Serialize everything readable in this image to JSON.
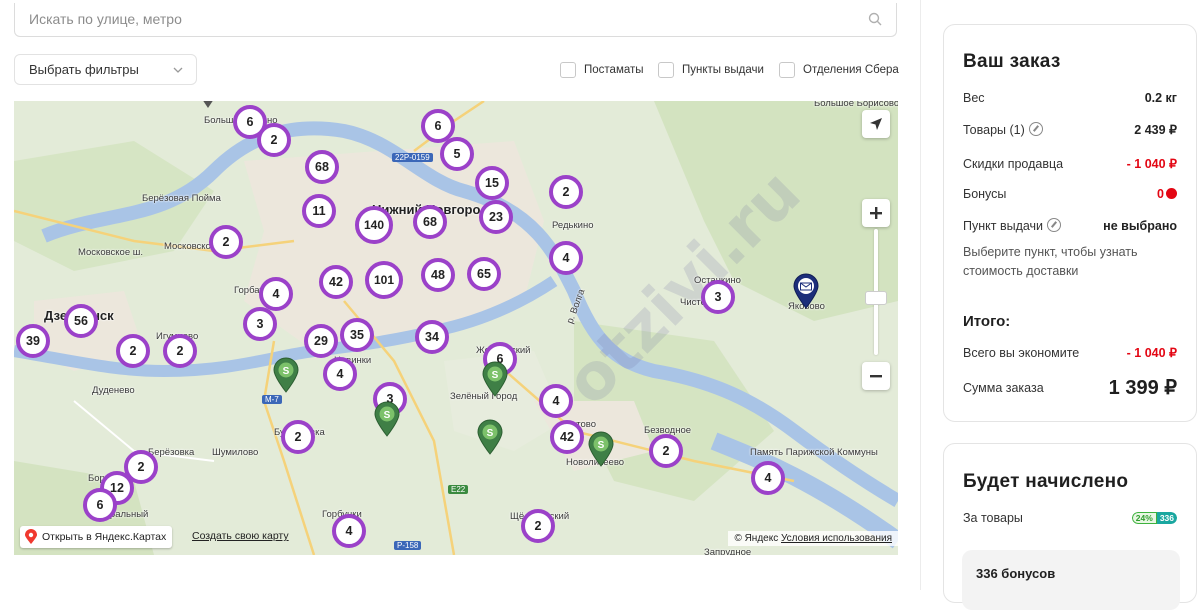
{
  "search": {
    "placeholder": "Искать по улице, метро"
  },
  "filters": {
    "select_label": "Выбрать фильтры",
    "checkboxes": [
      "Постаматы",
      "Пункты выдачи",
      "Отделения Сбера"
    ]
  },
  "map": {
    "watermark": "otzivi.ru",
    "labels": {
      "bolshoe_kozino": "Большое Козино",
      "berezovaya_poyma": "Берёзовая Пойма",
      "moskovskoe_sh_1": "Московское ш.",
      "moskovskoe_sh_2": "Московское ш.",
      "nizhny": "Нижний Новгород",
      "redkino": "Редькино",
      "dzerzhinsk": "Дзержинск",
      "gorbatovka": "Горбатовка",
      "igumnovo": "Игумново",
      "dudenevo": "Дуденево",
      "zelenyi_gorod": "Зелёный Город",
      "zhelninsky": "Желнинский",
      "kstovo": "Кстово",
      "novolikeevo": "Новоликеево",
      "bezvodnoe": "Безводное",
      "ostankino": "Останкино",
      "chistoe": "Чистое",
      "yakovo": "Яковово",
      "pamyat": "Память Парижской Коммуны",
      "shumilovo": "Шумилово",
      "berezovka": "Берёзовка",
      "bor": "Бор",
      "tsentralny": "Центральный",
      "burnakovo": "Бурнаковка",
      "novaya_pustyn": "Новинки",
      "gorbunovo": "Горбунки",
      "shchelokovo": "Щёлоковский",
      "volga": "р. Волга",
      "zapolnoe": "Запрудное",
      "top_right": "Большое Борисово"
    },
    "roads": {
      "r1": "22Р-0159",
      "r2": "M-7",
      "r3": "E22",
      "r4": "P-158"
    },
    "clusters": [
      "6",
      "2",
      "6",
      "5",
      "68",
      "15",
      "2",
      "11",
      "140",
      "68",
      "23",
      "2",
      "4",
      "4",
      "42",
      "101",
      "48",
      "65",
      "3",
      "56",
      "3",
      "39",
      "29",
      "35",
      "34",
      "2",
      "2",
      "6",
      "4",
      "3",
      "4",
      "42",
      "2",
      "2",
      "2",
      "4",
      "12",
      "6",
      "4",
      "2"
    ],
    "open_in_yandex": "Открыть в Яндекс.Картах",
    "make_map": "Создать свою карту",
    "attribution": "© Яндекс",
    "terms": "Условия использования",
    "colors": {
      "cluster": "#9b41c9",
      "sber_pin": "#2e8b3a",
      "post_pin": "#1c2e7a"
    }
  },
  "order": {
    "title": "Ваш заказ",
    "weight_label": "Вес",
    "weight_value": "0.2 кг",
    "goods_label": "Товары (1)",
    "goods_value": "2 439 ₽",
    "seller_discount_label": "Скидки продавца",
    "seller_discount_value": "- 1 040 ₽",
    "bonuses_label": "Бонусы",
    "bonuses_value": "0",
    "pickup_label": "Пункт выдачи",
    "pickup_value": "не выбрано",
    "pickup_hint": "Выберите пункт, чтобы узнать стоимость доставки",
    "total_title": "Итого:",
    "saved_label": "Всего вы экономите",
    "saved_value": "- 1 040 ₽",
    "sum_label": "Сумма заказа",
    "sum_value": "1 399 ₽",
    "accent_red": "#e30613"
  },
  "bonus": {
    "title": "Будет начислено",
    "for_goods_label": "За товары",
    "percent": "24%",
    "amount": "336",
    "box_text": "336 бонусов"
  }
}
